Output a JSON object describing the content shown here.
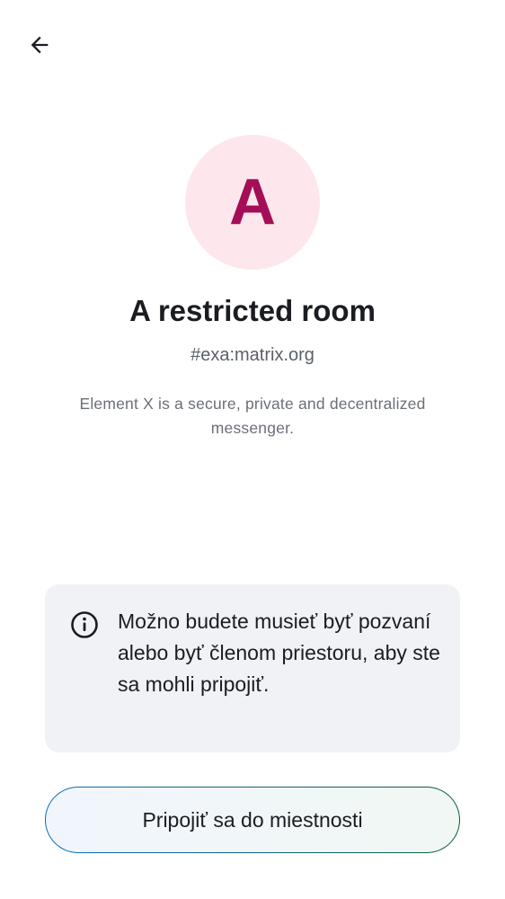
{
  "header": {
    "back_icon": "arrow-left-icon"
  },
  "room": {
    "avatar_letter": "A",
    "avatar_bg": "#fde6ec",
    "avatar_fg": "#a30e57",
    "name": "A restricted room",
    "alias": "#exa:matrix.org",
    "description": "Element X is a secure, private and decentralized messenger."
  },
  "notice": {
    "icon": "info-icon",
    "text": "Možno budete musieť byť pozvaní alebo byť členom priestoru, aby ste sa mohli pripojiť."
  },
  "actions": {
    "join_label": "Pripojiť sa do miestnosti",
    "accent_start": "#0c6bbf",
    "accent_end": "#0d5c43"
  }
}
